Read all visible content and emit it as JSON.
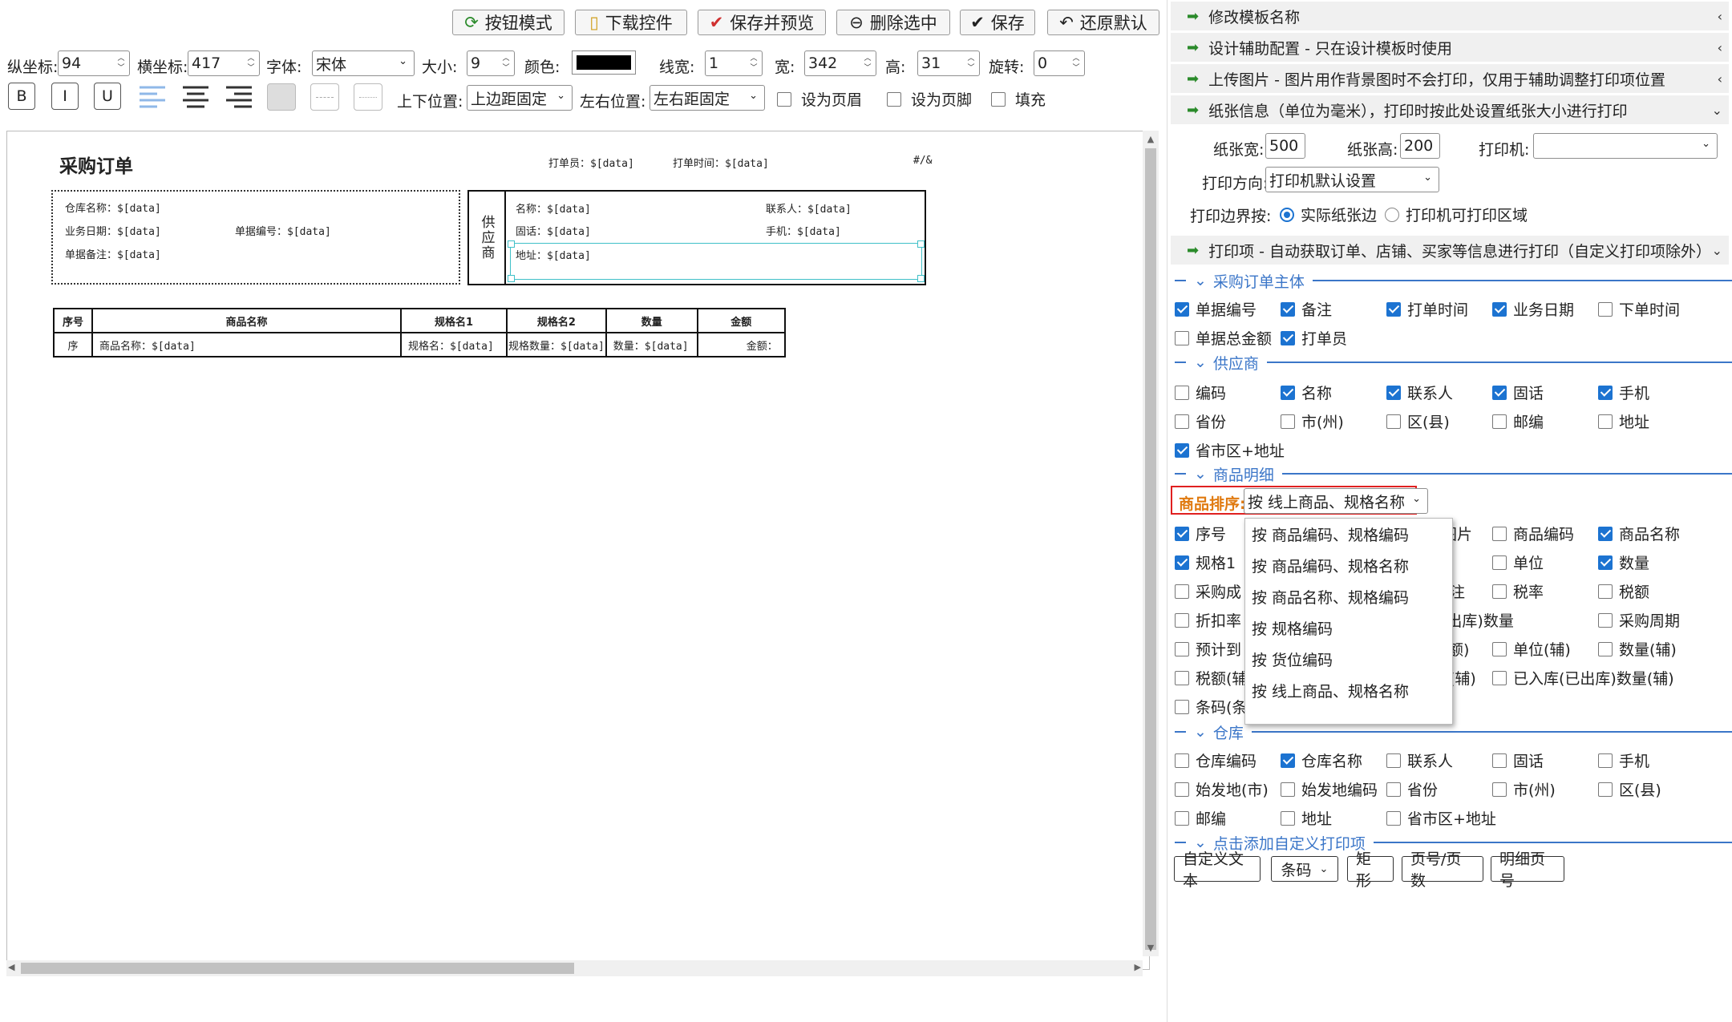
{
  "toolbar": {
    "buttons": [
      "按钮模式",
      "下载控件",
      "保存并预览",
      "删除选中",
      "保存",
      "还原默认"
    ],
    "y_label": "纵坐标:",
    "y_value": "94",
    "x_label": "横坐标:",
    "x_value": "417",
    "font_label": "字体:",
    "font_value": "宋体",
    "size_label": "大小:",
    "size_value": "9",
    "color_label": "颜色:",
    "linewidth_label": "线宽:",
    "linewidth_value": "1",
    "width_label": "宽:",
    "width_value": "342",
    "height_label": "高:",
    "height_value": "31",
    "rotate_label": "旋转:",
    "rotate_value": "0",
    "bold": "B",
    "italic": "I",
    "underline": "U",
    "vpos_label": "上下位置:",
    "vpos_value": "上边距固定",
    "hpos_label": "左右位置:",
    "hpos_value": "左右距固定",
    "header_label": "设为页眉",
    "footer_label": "设为页脚",
    "fill_label": "填充"
  },
  "doc": {
    "title": "采购订单",
    "printer": "打单员：$[data]",
    "print_time": "打单时间：$[data]",
    "page": "#/&",
    "warehouse": "仓库名称：$[data]",
    "biz_date": "业务日期：$[data]",
    "doc_no": "单据编号：$[data]",
    "remark": "单据备注：$[data]",
    "supplier_tag": "供应商",
    "s_name": "名称：$[data]",
    "s_contact": "联系人：$[data]",
    "s_tel": "固话：$[data]",
    "s_mobile": "手机：$[data]",
    "s_addr": "地址：$[data]",
    "headers": [
      "序号",
      "商品名称",
      "规格名1",
      "规格名2",
      "数量",
      "金额"
    ],
    "row": [
      "序",
      "商品名称：$[data]",
      "规格名：$[data]",
      "规格数量：$[data]",
      "数量：$[data]",
      "金额："
    ]
  },
  "panel": {
    "sections": [
      "修改模板名称",
      "设计辅助配置 - 只在设计模板时使用",
      "上传图片 - 图片用作背景图时不会打印，仅用于辅助调整打印项位置",
      "纸张信息（单位为毫米），打印时按此处设置纸张大小进行打印"
    ],
    "paper_w_label": "纸张宽:",
    "paper_w": "500",
    "paper_h_label": "纸张高:",
    "paper_h": "200",
    "printer_label": "打印机:",
    "printer_value": "",
    "orient_label": "打印方向:",
    "orient_value": "打印机默认设置",
    "border_label": "打印边界按:",
    "border_opt1": "实际纸张边",
    "border_opt2": "打印机可打印区域",
    "print_items": "打印项 - 自动获取订单、店铺、买家等信息进行打印（自定义打印项除外）",
    "g1": "采购订单主体",
    "g1_items": [
      [
        "单据编号",
        true
      ],
      [
        "备注",
        true
      ],
      [
        "打单时间",
        true
      ],
      [
        "业务日期",
        true
      ],
      [
        "下单时间",
        false
      ],
      [
        "单据总金额",
        false
      ],
      [
        "打单员",
        true
      ]
    ],
    "g2": "供应商",
    "g2_items": [
      [
        "编码",
        false
      ],
      [
        "名称",
        true
      ],
      [
        "联系人",
        true
      ],
      [
        "固话",
        true
      ],
      [
        "手机",
        true
      ],
      [
        "省份",
        false
      ],
      [
        "市(州)",
        false
      ],
      [
        "区(县)",
        false
      ],
      [
        "邮编",
        false
      ],
      [
        "地址",
        false
      ],
      [
        "省市区+地址",
        true
      ]
    ],
    "g3": "商品明细",
    "sort_label": "商品排序:",
    "sort_value": "按 线上商品、规格名称",
    "g3_left": [
      [
        "序号",
        true
      ],
      [
        "规格1",
        true
      ],
      [
        "采购成",
        false
      ],
      [
        "折扣率",
        false
      ],
      [
        "预计到",
        false
      ],
      [
        "税额(辅",
        false
      ],
      [
        "条码(条",
        false
      ]
    ],
    "g3_mid": [
      "图片",
      "注",
      "(已出库)数量",
      "本(辅)"
    ],
    "g3_right": [
      [
        "商品编码",
        false
      ],
      [
        "商品名称",
        true
      ],
      [
        "单位",
        false
      ],
      [
        "数量",
        true
      ],
      [
        "税率",
        false
      ],
      [
        "税额",
        false
      ],
      [
        "采购周期",
        false
      ],
      [
        "单位(辅)",
        false
      ],
      [
        "数量(辅)",
        false
      ],
      [
        "已入库(已出库)数量(辅)",
        false
      ]
    ],
    "g3_mid2": "额)",
    "dropdown": [
      "按 商品编码、规格编码",
      "按 商品编码、规格名称",
      "按 商品名称、规格编码",
      "按 规格编码",
      "按 货位编码",
      "按 线上商品、规格名称"
    ],
    "g4": "仓库",
    "g4_items": [
      [
        "仓库编码",
        false
      ],
      [
        "仓库名称",
        true
      ],
      [
        "联系人",
        false
      ],
      [
        "固话",
        false
      ],
      [
        "手机",
        false
      ],
      [
        "始发地(市)",
        false
      ],
      [
        "始发地编码",
        false
      ],
      [
        "省份",
        false
      ],
      [
        "市(州)",
        false
      ],
      [
        "区(县)",
        false
      ],
      [
        "邮编",
        false
      ],
      [
        "地址",
        false
      ],
      [
        "省市区+地址",
        false
      ]
    ],
    "g5": "点击添加自定义打印项",
    "custom_buttons": [
      "自定义文本",
      "条码",
      "矩形",
      "页号/页数",
      "明细页号"
    ]
  }
}
